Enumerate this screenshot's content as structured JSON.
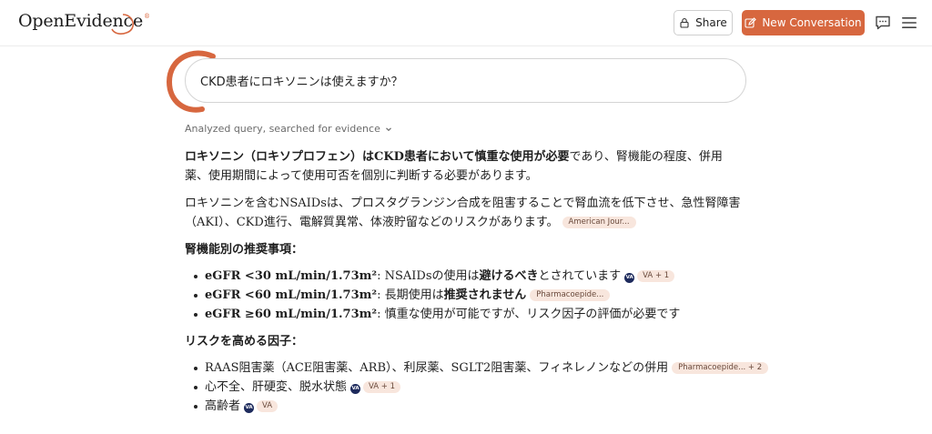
{
  "header": {
    "logo_text": "OpenEvidence",
    "logo_reg": "®",
    "share_label": "Share",
    "new_conversation_label": "New Conversation",
    "accent": "#d7673f"
  },
  "query": {
    "text": "CKD患者にロキソニンは使えますか？"
  },
  "status": {
    "analyzed_text": "Analyzed query, searched for evidence"
  },
  "answer": {
    "p1_bold": "ロキソニン（ロキソプロフェン）はCKD患者において慎重な使用が必要",
    "p1_rest": "であり、腎機能の程度、併用薬、使用期間によって使用可否を個別に判断する必要があります。",
    "p2_text": "ロキソニンを含むNSAIDsは、プロスタグランジン合成を阻害することで腎血流を低下させ、急性腎障害（AKI）、CKD進行、電解質異常、体液貯留などのリスクがあります。",
    "p2_cite": "American Jour...",
    "section1_title": "腎機能別の推奨事項：",
    "section1_items": [
      {
        "bold": "eGFR <30 mL/min/1.73m²",
        "text_before": ": NSAIDsの使用は",
        "emph": "避けるべき",
        "text_after": "とされています",
        "badge": "VA",
        "cite": "VA + 1"
      },
      {
        "bold": "eGFR <60 mL/min/1.73m²",
        "text_before": ": 長期使用は",
        "emph": "推奨されません",
        "text_after": "",
        "cite": "Pharmacoepide..."
      },
      {
        "bold": "eGFR ≥60 mL/min/1.73m²",
        "text_before": ": 慎重な使用が可能ですが、リスク因子の評価が必要です",
        "emph": "",
        "text_after": ""
      }
    ],
    "section2_title": "リスクを高める因子：",
    "section2_items": [
      {
        "text": "RAAS阻害薬（ACE阻害薬、ARB）、利尿薬、SGLT2阻害薬、フィネレノンなどの併用",
        "cite": "Pharmacoepide... + 2"
      },
      {
        "text": "心不全、肝硬変、脱水状態",
        "badge": "VA",
        "cite": "VA + 1"
      },
      {
        "text": "高齢者",
        "badge": "VA",
        "cite": "VA"
      }
    ]
  },
  "icons": {
    "share": "lock-share-icon",
    "new_conversation": "edit-icon",
    "chat": "chat-bubble-icon",
    "menu": "hamburger-icon",
    "chevron": "chevron-down-icon"
  }
}
